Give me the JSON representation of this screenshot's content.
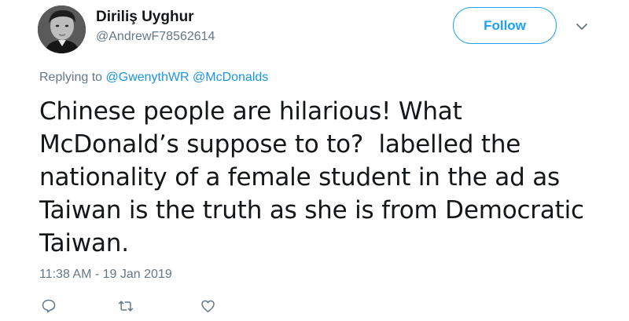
{
  "author": {
    "display_name": "Diriliş Uyghur",
    "handle": "@AndrewF78562614",
    "avatar_icon": "profile-photo"
  },
  "follow_button": {
    "label": "Follow"
  },
  "menu": {
    "icon": "chevron-down-icon"
  },
  "reply_context": {
    "prefix": "Replying to",
    "mentions": [
      "@GwenythWR",
      "@McDonalds"
    ]
  },
  "tweet": {
    "lines": [
      "Chinese people are hilarious! What",
      "McDonald’s suppose to to?  labelled the",
      "nationality of a female student in the ad as",
      "Taiwan is the truth as she is from Democratic",
      "Taiwan."
    ],
    "timestamp": "11:38 AM - 19 Jan 2019"
  },
  "actions": [
    {
      "name": "reply",
      "icon": "reply-icon"
    },
    {
      "name": "retweet",
      "icon": "retweet-icon"
    },
    {
      "name": "like",
      "icon": "heart-icon"
    }
  ],
  "colors": {
    "accent": "#1da1f2",
    "link": "#1b95e0",
    "secondary_text": "#657786",
    "primary_text": "#14171a"
  }
}
